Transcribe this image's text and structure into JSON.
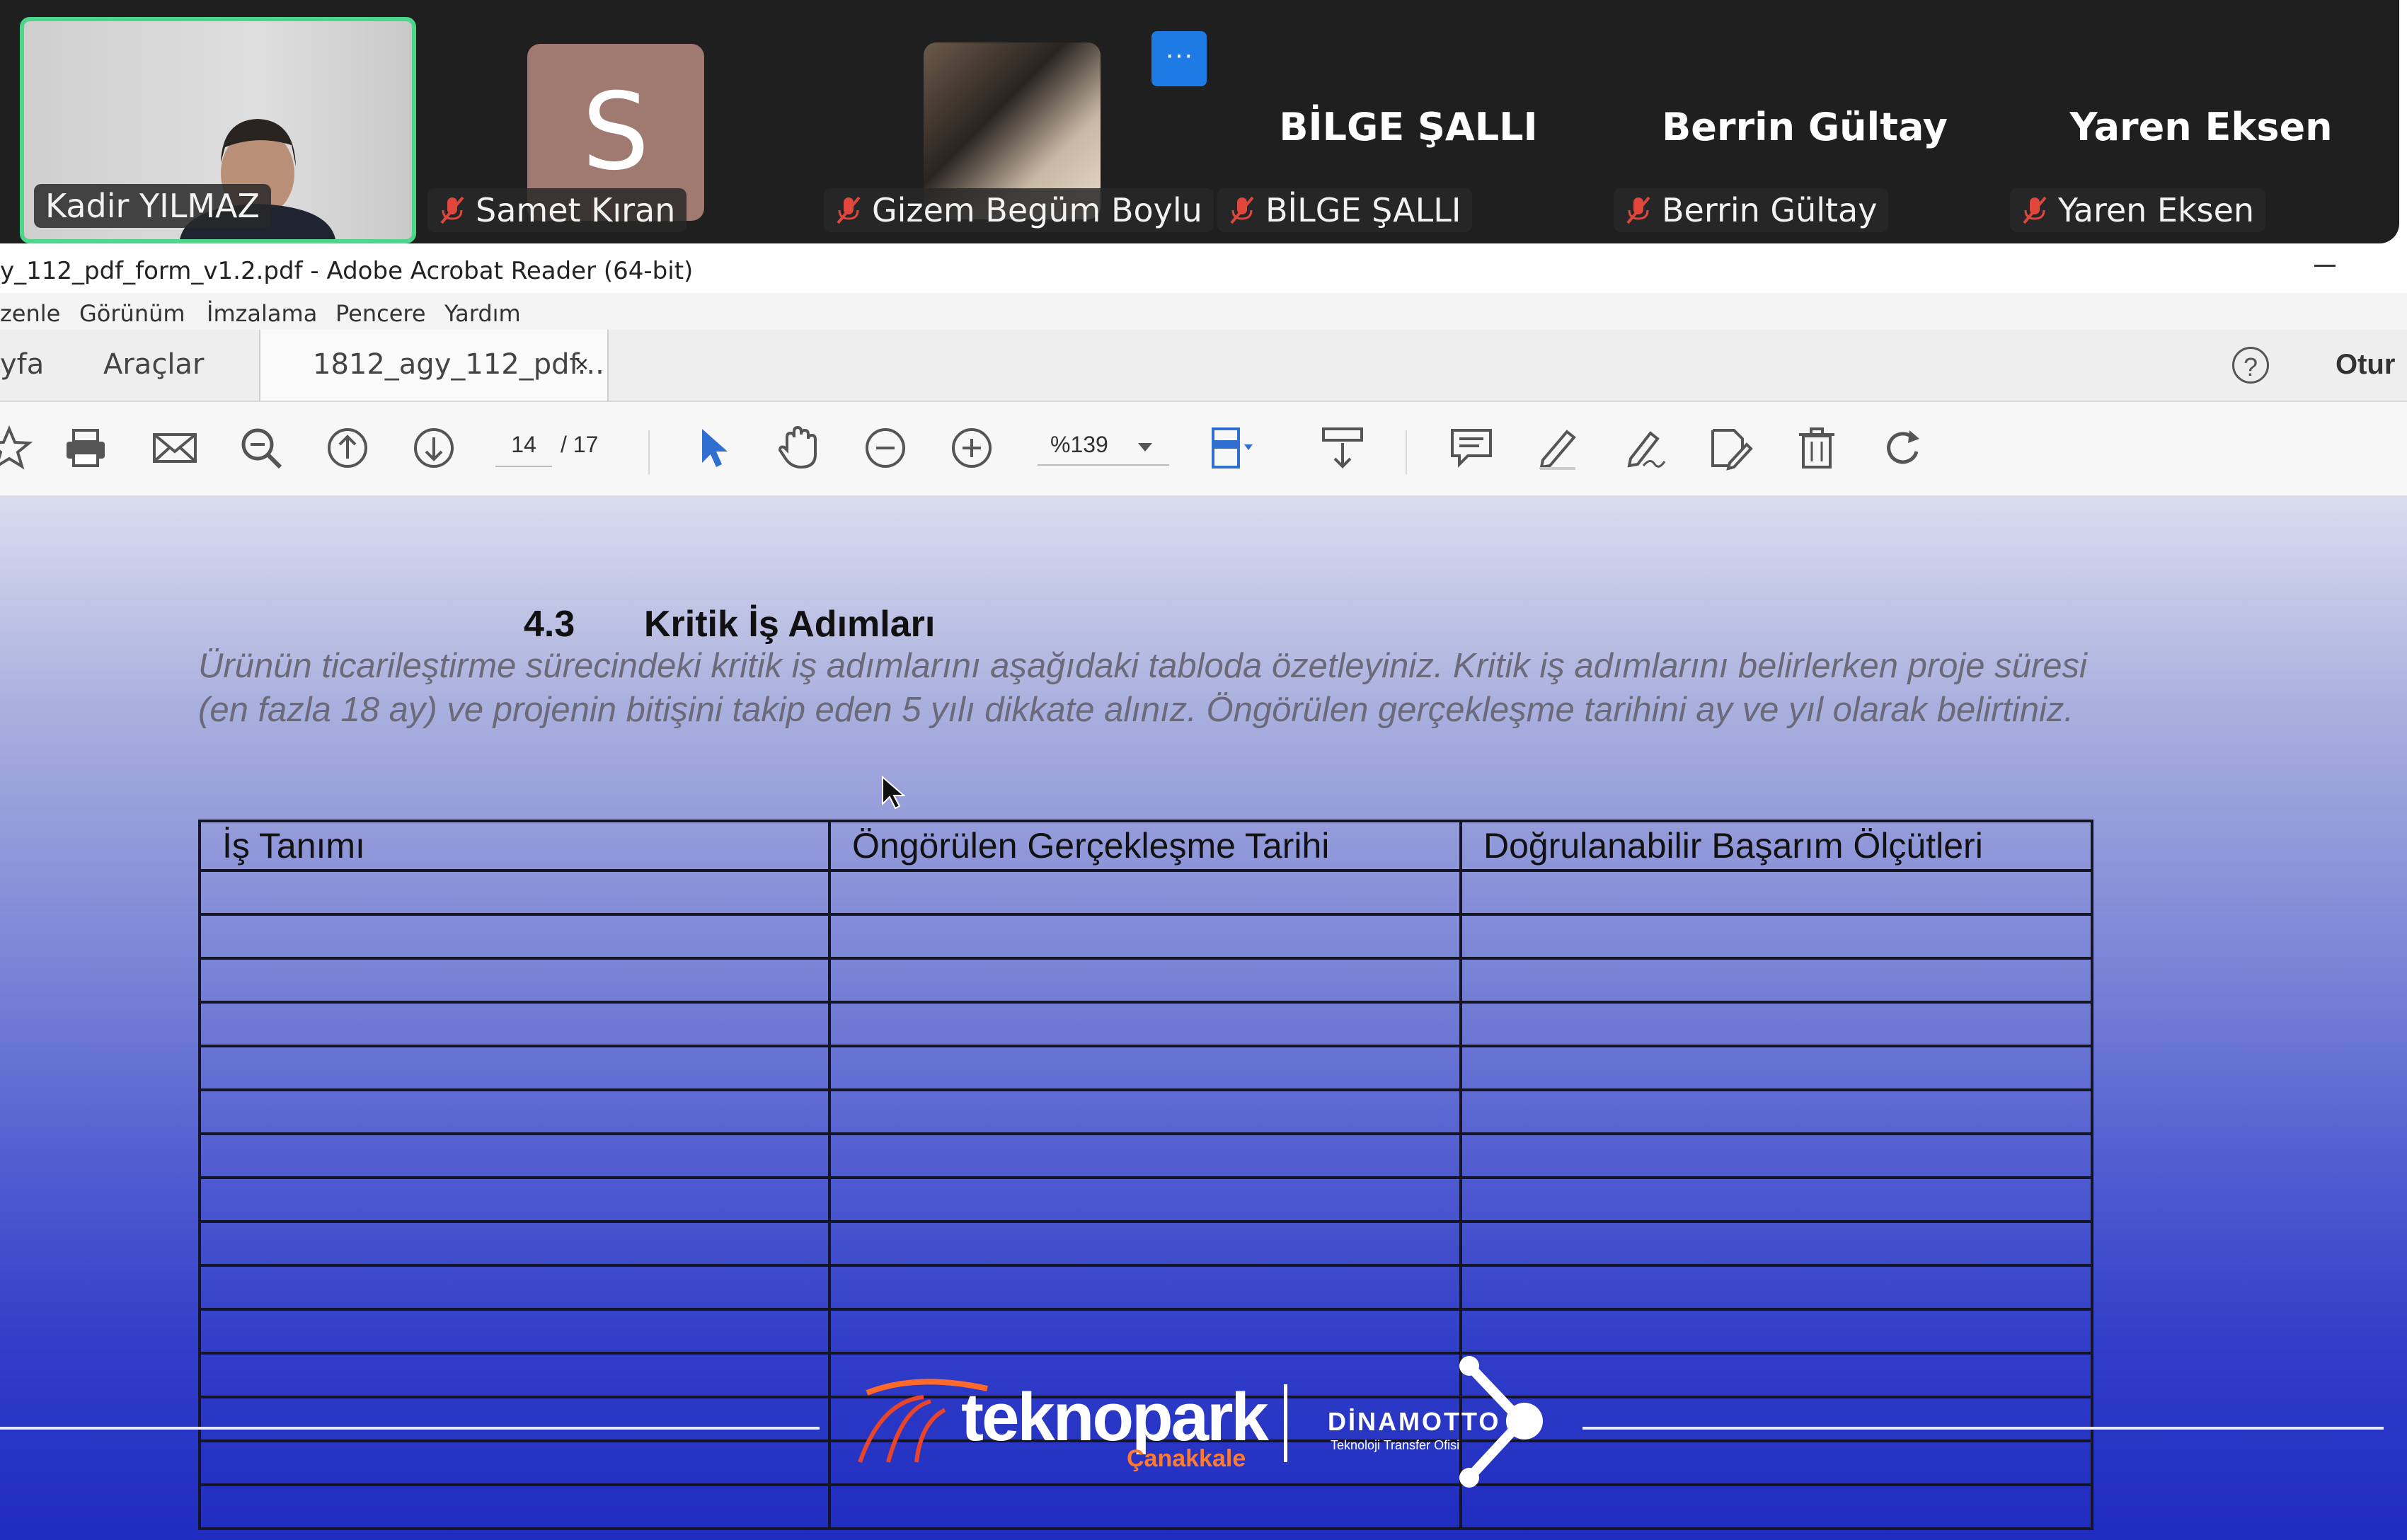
{
  "meeting": {
    "participants": [
      {
        "name": "Kadir YILMAZ"
      },
      {
        "name": "Samet Kıran",
        "initial": "S"
      },
      {
        "name": "Gizem Begüm Boylu"
      },
      {
        "name": "BİLGE ŞALLI",
        "display": "BİLGE ŞALLI"
      },
      {
        "name": "Berrin Gültay",
        "display": "Berrin Gültay"
      },
      {
        "name": "Yaren Eksen",
        "display": "Yaren Eksen"
      }
    ],
    "more_label": "···",
    "colors": {
      "active_border": "#4cd68a",
      "more_button": "#1e7be6",
      "muted_mic": "#e0463c"
    }
  },
  "acrobat": {
    "window_title": "y_112_pdf_form_v1.2.pdf - Adobe Acrobat Reader (64-bit)",
    "menu": [
      "zenle",
      "Görünüm",
      "İmzalama",
      "Pencere",
      "Yardım"
    ],
    "tabs": {
      "home": "yfa",
      "tools": "Araçlar",
      "document": "1812_agy_112_pdf...",
      "close": "×"
    },
    "help": "?",
    "signin": "Otur",
    "page_current": "14",
    "page_total": "/  17",
    "zoom": "%139"
  },
  "document": {
    "section_number": "4.3",
    "section_title": "Kritik İş Adımları",
    "instructions": "Ürünün ticarileştirme sürecindeki kritik iş adımlarını aşağıdaki tabloda özetleyiniz. Kritik iş adımlarını belirlerken proje süresi (en fazla 18 ay) ve projenin bitişini takip eden 5 yılı dikkate alınız. Öngörülen gerçekleşme tarihini ay ve yıl olarak belirtiniz.",
    "table": {
      "headers": [
        "İş Tanımı",
        "Öngörülen Gerçekleşme Tarihi",
        "Doğrulanabilir Başarım Ölçütleri"
      ],
      "empty_rows": 15
    }
  },
  "branding": {
    "teknopark": "teknopark",
    "city": "Çanakkale",
    "dinamotto": "DİNAMOTTO",
    "tto": "Teknoloji Transfer Ofisi"
  }
}
